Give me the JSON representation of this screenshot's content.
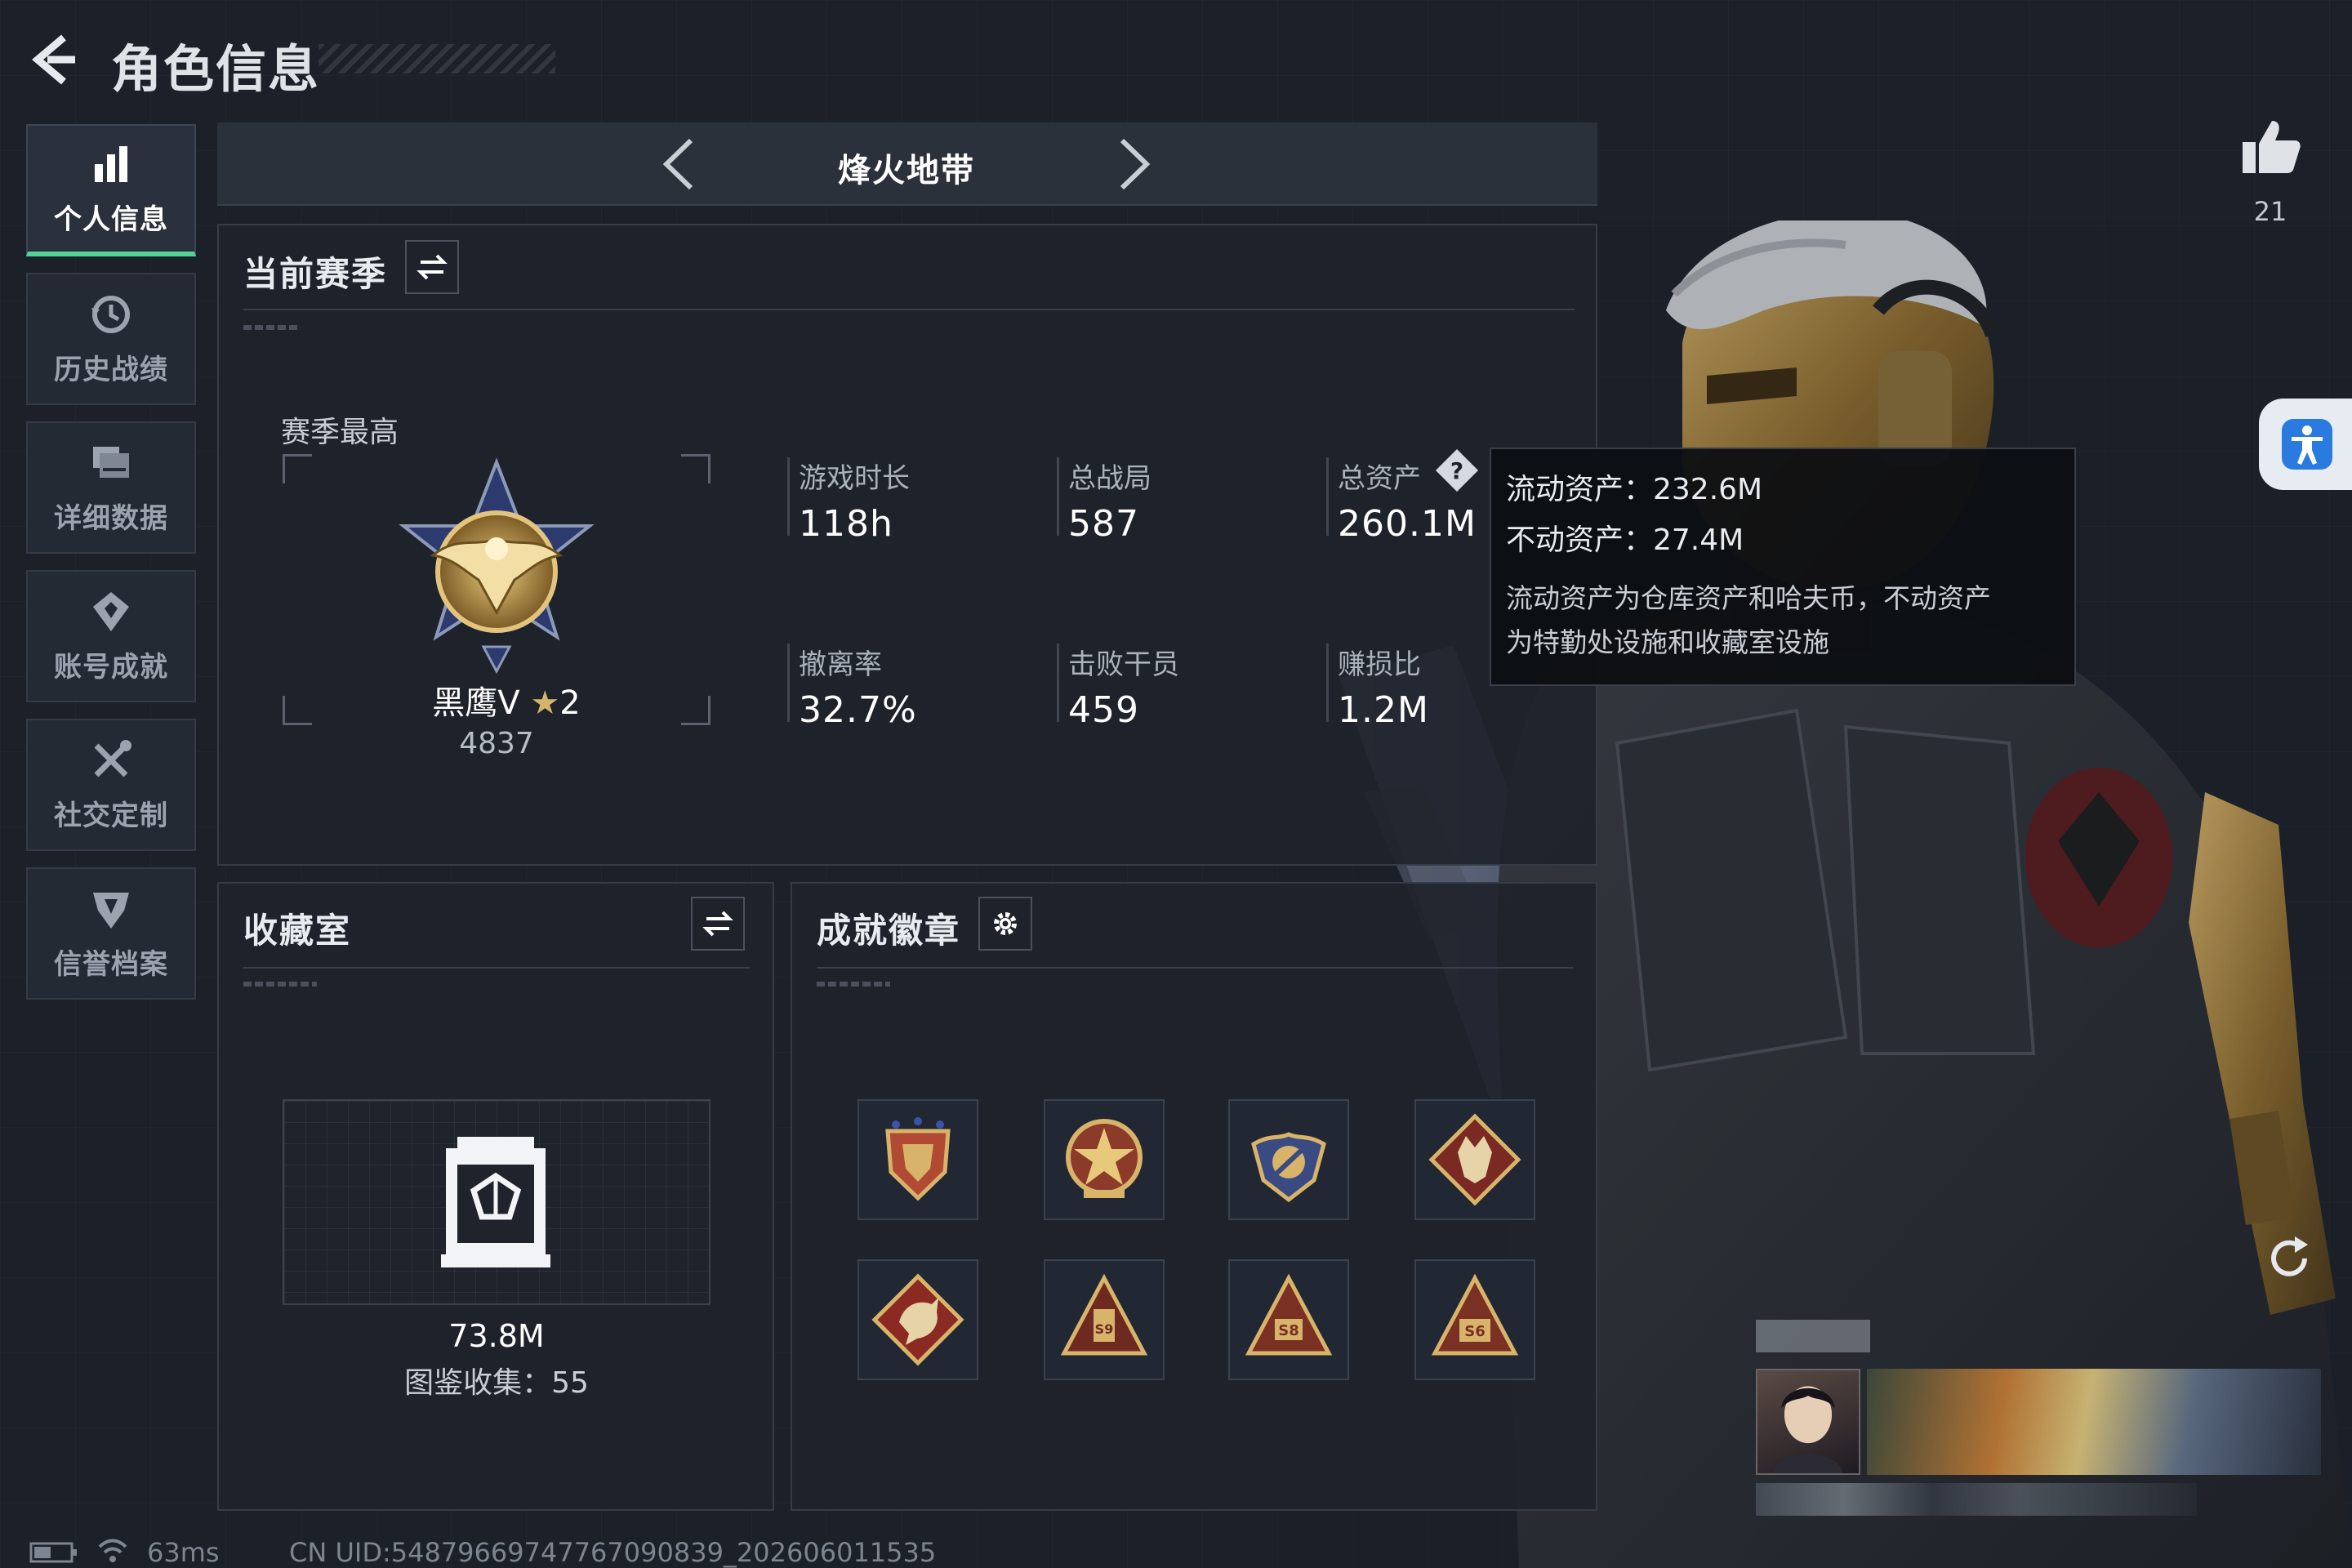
{
  "header": {
    "title": "角色信息"
  },
  "nav": {
    "items": [
      {
        "label": "个人信息",
        "icon": "bar-chart-icon",
        "active": true
      },
      {
        "label": "历史战绩",
        "icon": "history-icon",
        "active": false
      },
      {
        "label": "详细数据",
        "icon": "folder-icon",
        "active": false
      },
      {
        "label": "账号成就",
        "icon": "achievement-icon",
        "active": false
      },
      {
        "label": "社交定制",
        "icon": "tools-icon",
        "active": false
      },
      {
        "label": "信誉档案",
        "icon": "shield-icon",
        "active": false
      }
    ]
  },
  "mode": {
    "label": "烽火地带"
  },
  "season": {
    "title": "当前赛季",
    "best_label": "赛季最高",
    "rank_name": "黑鹰V",
    "rank_stars": "2",
    "rank_points": "4837",
    "stats": [
      {
        "label": "游戏时长",
        "value": "118h"
      },
      {
        "label": "总战局",
        "value": "587"
      },
      {
        "label": "总资产",
        "value": "260.1M"
      },
      {
        "label": "撤离率",
        "value": "32.7%"
      },
      {
        "label": "击败干员",
        "value": "459"
      },
      {
        "label": "赚损比",
        "value": "1.2M"
      }
    ]
  },
  "tooltip": {
    "liquid": "流动资产：232.6M",
    "fixed": "不动资产：27.4M",
    "note_line1": "流动资产为仓库资产和哈夫币，不动资产",
    "note_line2": "为特勤处设施和收藏室设施"
  },
  "collection": {
    "title": "收藏室",
    "value": "73.8M",
    "codex": "图鉴收集：55"
  },
  "achievements": {
    "title": "成就徽章",
    "badges": [
      {
        "icon": "shield-crest-badge-icon",
        "text": ""
      },
      {
        "icon": "star-medal-badge-icon",
        "text": ""
      },
      {
        "icon": "wings-shield-badge-icon",
        "text": ""
      },
      {
        "icon": "wolf-diamond-badge-icon",
        "text": ""
      },
      {
        "icon": "dragon-diamond-badge-icon",
        "text": ""
      },
      {
        "icon": "tower-badge-icon",
        "text": "S9"
      },
      {
        "icon": "triangle-badge-icon",
        "text": "S8"
      },
      {
        "icon": "triangle-badge-icon",
        "text": "S6"
      }
    ]
  },
  "like": {
    "count": "21"
  },
  "footer": {
    "ping": "63ms",
    "uid": "CN UID:5487966974776709083​9_202606011535"
  },
  "colors": {
    "accent": "#52d398",
    "gold": "#c9a35a",
    "background": "#1b2029"
  }
}
